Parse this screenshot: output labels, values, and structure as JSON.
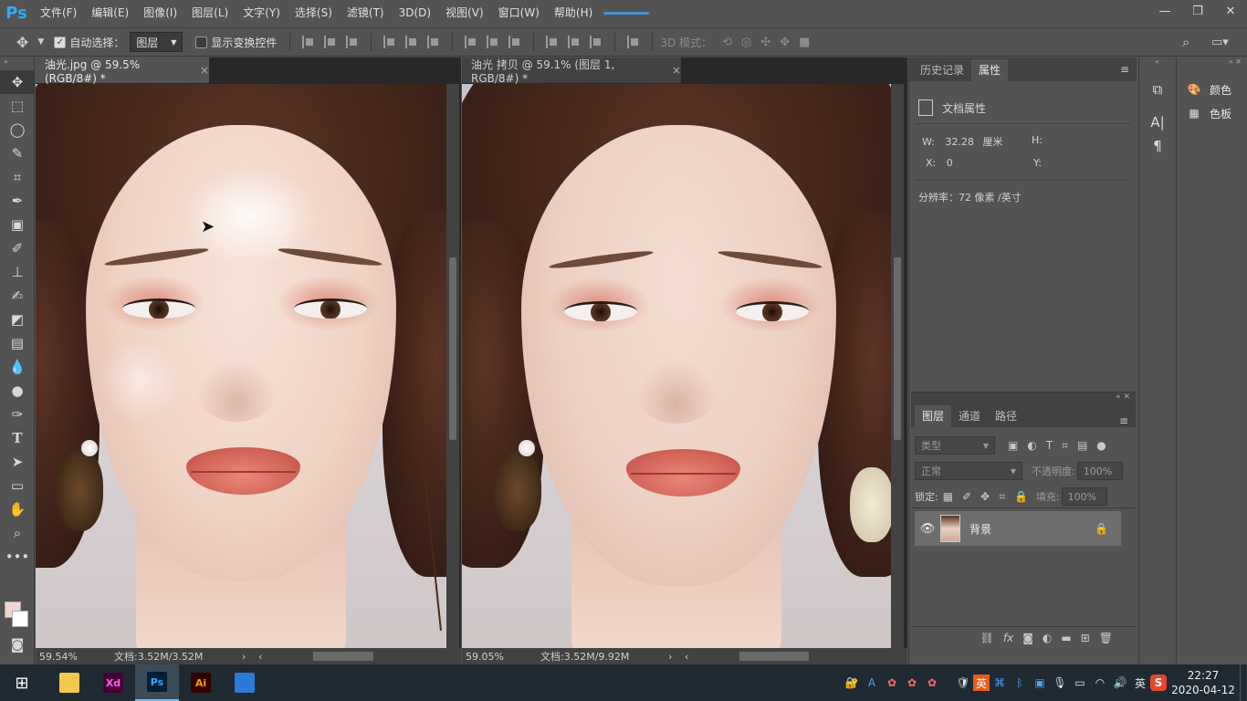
{
  "app": {
    "logo": "Ps"
  },
  "menu": [
    "文件(F)",
    "编辑(E)",
    "图像(I)",
    "图层(L)",
    "文字(Y)",
    "选择(S)",
    "滤镜(T)",
    "3D(D)",
    "视图(V)",
    "窗口(W)",
    "帮助(H)"
  ],
  "window_controls": {
    "minimize": "—",
    "restore": "❐",
    "close": "✕"
  },
  "options": {
    "auto_select_label": "自动选择：",
    "auto_select_value": "图层",
    "show_transform_label": "显示变换控件",
    "mode_3d_label": "3D 模式："
  },
  "docs": [
    {
      "title": "油光.jpg @ 59.5%(RGB/8#) *",
      "zoom": "59.54%",
      "doc_info": "文档:3.52M/3.52M"
    },
    {
      "title": "油光 拷贝 @ 59.1% (图层 1, RGB/8#) *",
      "zoom": "59.05%",
      "doc_info": "文档:3.52M/9.92M"
    }
  ],
  "properties_panel": {
    "tabs": [
      "历史记录",
      "属性"
    ],
    "active_tab": "属性",
    "heading": "文档属性",
    "w_label": "W:",
    "w_value": "32.28",
    "w_unit": "厘米",
    "h_label": "H:",
    "x_label": "X:",
    "x_value": "0",
    "y_label": "Y:",
    "resolution": "分辨率：72 像素 /英寸"
  },
  "layers_panel": {
    "tabs": [
      "图层",
      "通道",
      "路径"
    ],
    "active_tab": "图层",
    "filter_placeholder": "类型",
    "blend_mode": "正常",
    "opacity_label": "不透明度:",
    "opacity_value": "100%",
    "lock_label": "锁定:",
    "fill_label": "填充:",
    "fill_value": "100%",
    "layers": [
      {
        "name": "背景",
        "visible": true,
        "locked": true
      }
    ]
  },
  "side_panel": {
    "color_label": "颜色",
    "swatches_label": "色板"
  },
  "taskbar": {
    "apps": [
      {
        "name": "file-explorer",
        "label": ""
      },
      {
        "name": "adobe-xd",
        "label": "Xd",
        "color": "#ff61f6",
        "bg": "#470137"
      },
      {
        "name": "photoshop",
        "label": "Ps",
        "color": "#31a8ff",
        "bg": "#001e36"
      },
      {
        "name": "illustrator",
        "label": "Ai",
        "color": "#ff9a00",
        "bg": "#330000"
      },
      {
        "name": "window-app",
        "label": ""
      }
    ],
    "ime": "英",
    "ime2": "英",
    "time": "22:27",
    "date": "2020-04-12"
  }
}
